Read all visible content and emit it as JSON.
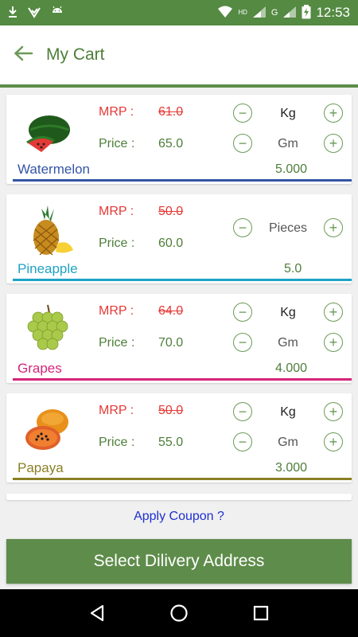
{
  "status_bar": {
    "time": "12:53",
    "network": "G",
    "hd": "HD",
    "icons": [
      "download-icon",
      "check-icon",
      "android-icon",
      "wifi-icon",
      "signal-icon",
      "battery-charging-icon"
    ]
  },
  "app_bar": {
    "title": "My Cart",
    "back_icon": "arrow-back-icon"
  },
  "labels": {
    "mrp": "MRP :",
    "price": "Price :"
  },
  "items": [
    {
      "name": "Watermelon",
      "mrp": "61.0",
      "price": "65.0",
      "unit_primary": "Kg",
      "unit_secondary": "Gm",
      "quantity": "5.000",
      "accent": "#3455a6",
      "icon": "watermelon-image"
    },
    {
      "name": "Pineapple",
      "mrp": "50.0",
      "price": "60.0",
      "unit_primary": "Pieces",
      "quantity": "5.0",
      "accent": "#1ea3c4",
      "icon": "pineapple-image"
    },
    {
      "name": "Grapes",
      "mrp": "64.0",
      "price": "70.0",
      "unit_primary": "Kg",
      "unit_secondary": "Gm",
      "quantity": "4.000",
      "accent": "#d3257a",
      "icon": "grapes-image"
    },
    {
      "name": "Papaya",
      "mrp": "50.0",
      "price": "55.0",
      "unit_primary": "Kg",
      "unit_secondary": "Gm",
      "quantity": "3.000",
      "accent": "#8a7f24",
      "icon": "papaya-image"
    }
  ],
  "coupon_link": "Apply Coupon ?",
  "cta_button": "Select Dilivery Address",
  "nav": [
    "back-triangle-icon",
    "home-circle-icon",
    "recents-square-icon"
  ],
  "colors": {
    "primary": "#5e8c4a",
    "mrp_red": "#e53935",
    "coupon_blue": "#1f2fd0"
  }
}
